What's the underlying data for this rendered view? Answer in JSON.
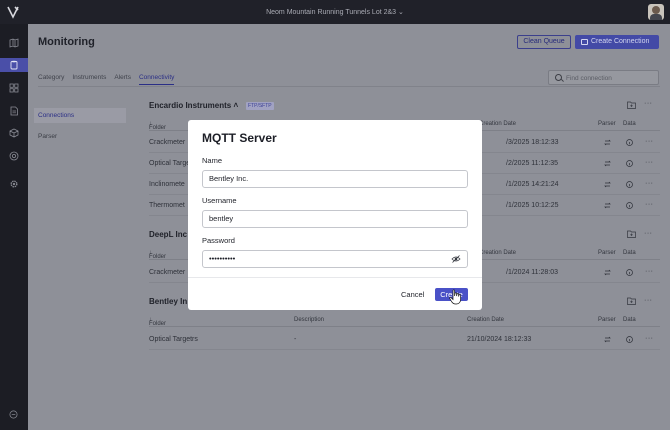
{
  "topbar": {
    "project_name": "Neom Mountain Running Tunnels Lot 2&3"
  },
  "sidebar": {
    "icons": [
      "map-icon",
      "clipboard-icon",
      "grid-icon",
      "document-icon",
      "cube-icon",
      "settings-circle-icon",
      "gear-icon"
    ],
    "active": "clipboard-icon",
    "bottom_icon": "help-icon"
  },
  "page": {
    "title": "Monitoring",
    "clean_queue_label": "Clean Queue",
    "create_connection_label": "Create Connection",
    "tabs": [
      {
        "label": "Category"
      },
      {
        "label": "Instruments"
      },
      {
        "label": "Alerts"
      },
      {
        "label": "Connectivity",
        "active": true
      }
    ],
    "search_placeholder": "Find connection",
    "left_nav": [
      {
        "label": "Connections",
        "active": true
      },
      {
        "label": "Parser"
      }
    ]
  },
  "columns": {
    "folder": "Folder",
    "description": "Description",
    "creation_date": "Creation Date",
    "parser": "Parser",
    "data": "Data"
  },
  "sections": [
    {
      "title": "Encardio Instruments",
      "tag": "FTP/SFTP",
      "rows": [
        {
          "folder": "Crackmeter",
          "date": "/3/2025 18:12:33"
        },
        {
          "folder": "Optical Targe",
          "date": "/2/2025 11:12:35"
        },
        {
          "folder": "Inclinomete",
          "date": "/1/2025 14:21:24"
        },
        {
          "folder": "Thermomet",
          "date": "/1/2025 10:12:25"
        }
      ]
    },
    {
      "title": "DeepL Inc",
      "rows": [
        {
          "folder": "Crackmeter",
          "date": "/1/2024 11:28:03"
        }
      ]
    },
    {
      "title": "Bentley In",
      "rows": [
        {
          "folder": "Optical Targetrs",
          "description": "-",
          "date": "21/10/2024 18:12:33"
        }
      ]
    }
  ],
  "modal": {
    "title": "MQTT Server",
    "name_label": "Name",
    "name_value": "Bentley Inc.",
    "username_label": "Username",
    "username_value": "bentley",
    "password_label": "Password",
    "password_value": "••••••••••",
    "cancel_label": "Cancel",
    "create_label": "Create"
  }
}
